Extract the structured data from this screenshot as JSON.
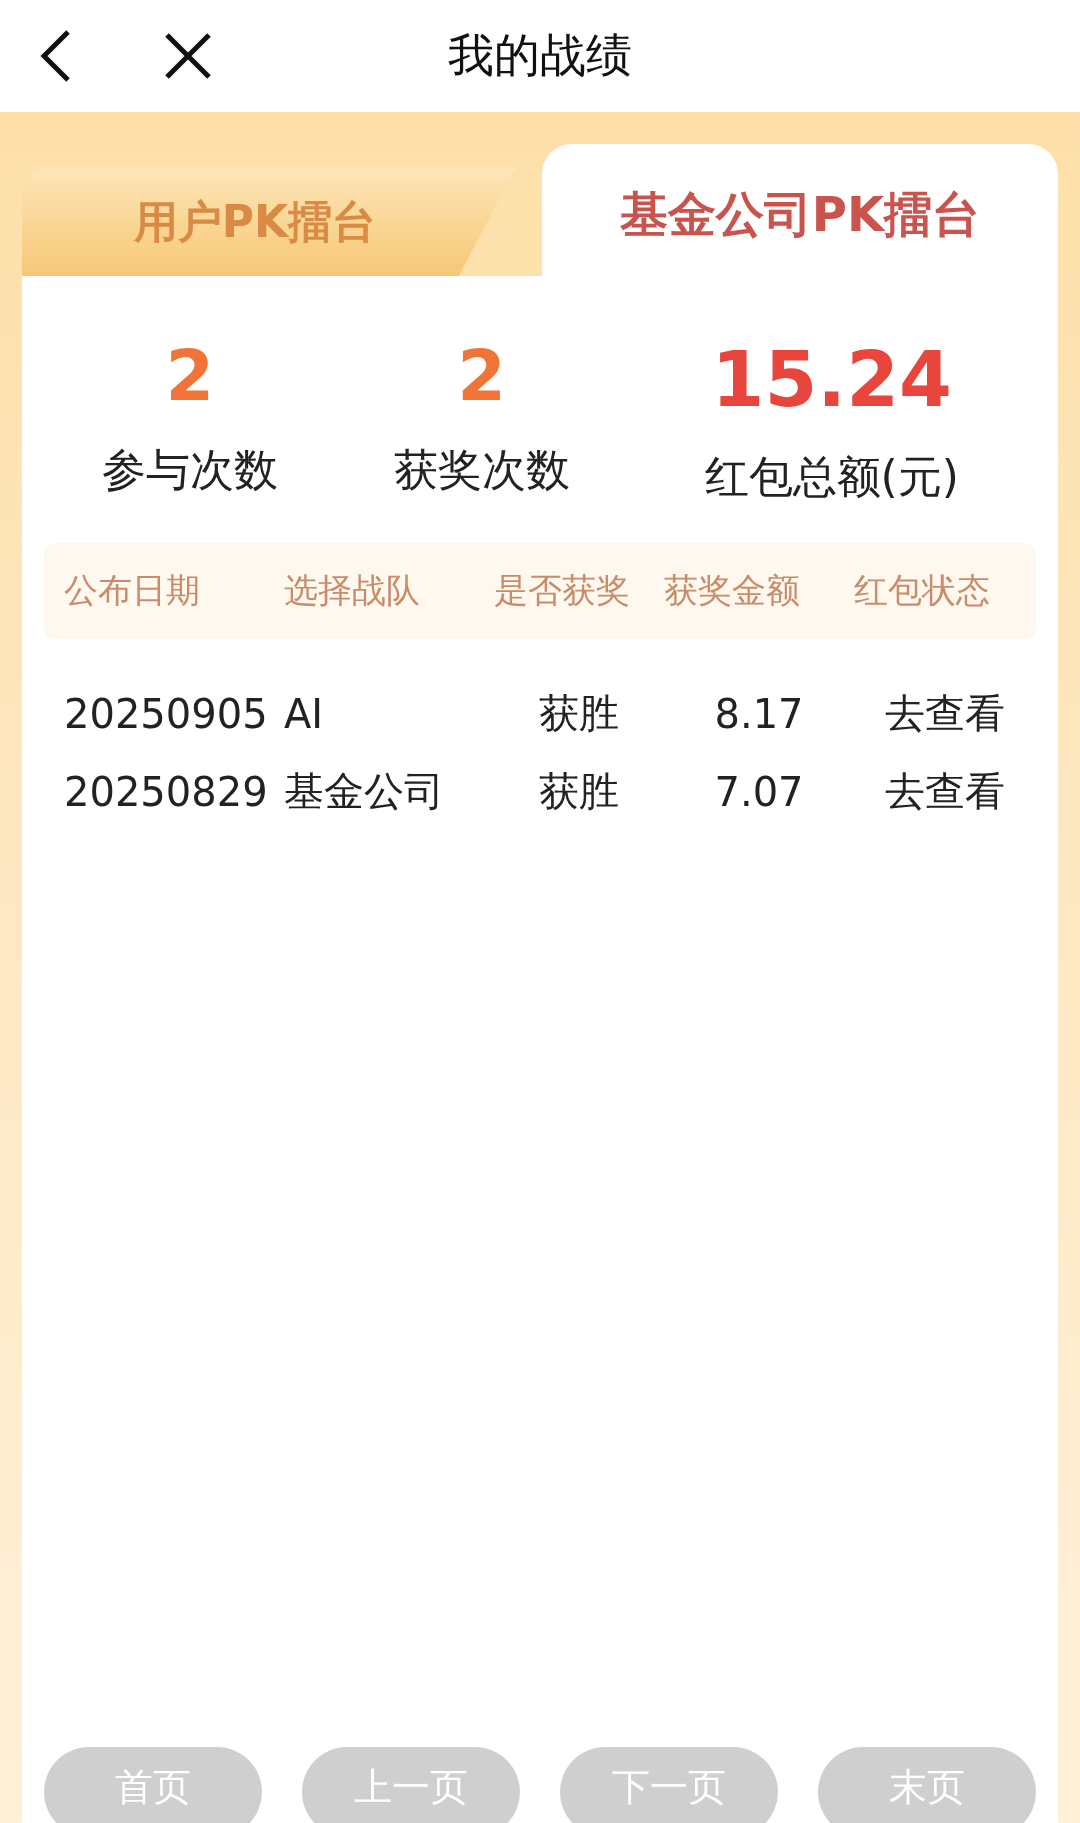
{
  "header": {
    "title": "我的战绩"
  },
  "tabs": [
    {
      "label": "用户PK擂台",
      "selected": false
    },
    {
      "label": "基金公司PK擂台",
      "selected": true
    }
  ],
  "stats": [
    {
      "value": "2",
      "label": "参与次数",
      "kind": "count"
    },
    {
      "value": "2",
      "label": "获奖次数",
      "kind": "count"
    },
    {
      "value": "15.24",
      "label": "红包总额(元)",
      "kind": "money"
    }
  ],
  "table": {
    "columns": [
      "公布日期",
      "选择战队",
      "是否获奖",
      "获奖金额",
      "红包状态"
    ],
    "rows": [
      {
        "cells": [
          "20250905",
          "AI",
          "获胜",
          "8.17",
          "去查看"
        ]
      },
      {
        "cells": [
          "20250829",
          "基金公司",
          "获胜",
          "7.07",
          "去查看"
        ]
      }
    ]
  },
  "pagination": [
    {
      "label": "首页",
      "disabled": true
    },
    {
      "label": "上一页",
      "disabled": true
    },
    {
      "label": "下一页",
      "disabled": true
    },
    {
      "label": "末页",
      "disabled": true
    }
  ]
}
